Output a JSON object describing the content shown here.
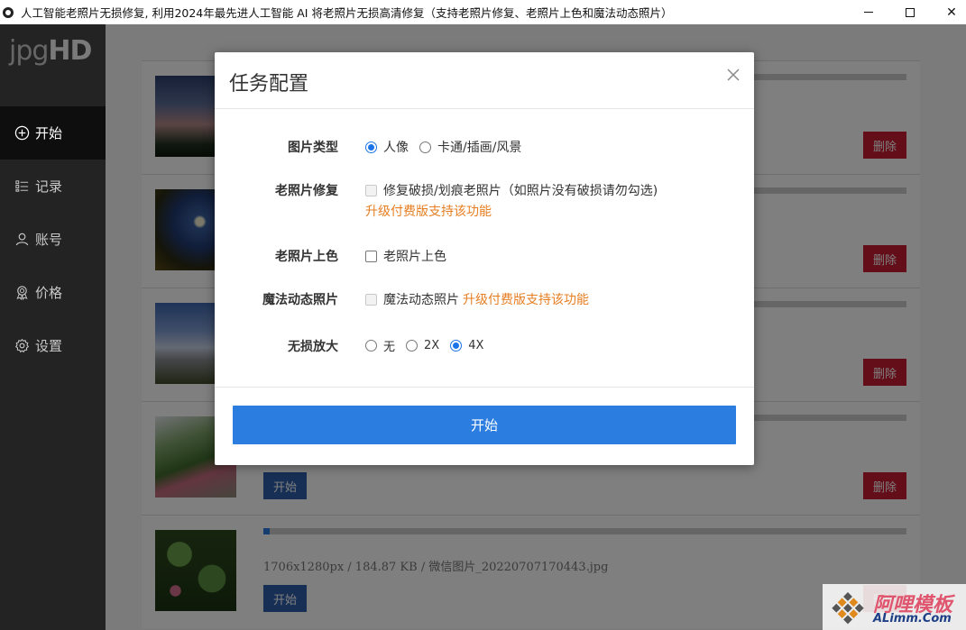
{
  "window": {
    "title": "人工智能老照片无损修复, 利用2024年最先进人工智能 AI 将老照片无损高清修复（支持老照片修复、老照片上色和魔法动态照片）",
    "min_icon": "minimize-icon",
    "max_icon": "maximize-icon",
    "close_glyph": "✕"
  },
  "sidebar": {
    "logo_light": "jpg",
    "logo_bold": "HD",
    "items": [
      {
        "label": "开始",
        "icon": "plus-circle-icon",
        "active": true
      },
      {
        "label": "记录",
        "icon": "list-icon",
        "active": false
      },
      {
        "label": "账号",
        "icon": "user-icon",
        "active": false
      },
      {
        "label": "价格",
        "icon": "award-icon",
        "active": false
      },
      {
        "label": "设置",
        "icon": "gear-icon",
        "active": false
      }
    ]
  },
  "list": {
    "start_label": "开始",
    "delete_label": "删除",
    "items": [
      {
        "meta": "",
        "progress": 0,
        "show_start": false
      },
      {
        "meta": "",
        "progress": 0,
        "show_start": false
      },
      {
        "meta": "",
        "progress": 0,
        "show_start": false
      },
      {
        "meta": "",
        "progress": 0,
        "show_start": true
      },
      {
        "meta": "1706x1280px / 184.87 KB / 微信图片_20220707170443.jpg",
        "progress": 0.01,
        "show_start": true
      }
    ]
  },
  "dialog": {
    "title": "任务配置",
    "close_glyph": "✕",
    "image_type": {
      "label": "图片类型",
      "options": [
        "人像",
        "卡通/插画/风景"
      ],
      "selected": 0
    },
    "restore": {
      "label": "老照片修复",
      "option": "修复破损/划痕老照片（如照片没有破损请勿勾选)",
      "upgrade": "升级付费版支持该功能",
      "checked": false,
      "disabled": true
    },
    "colorize": {
      "label": "老照片上色",
      "option": "老照片上色",
      "checked": false
    },
    "magic": {
      "label": "魔法动态照片",
      "option": "魔法动态照片",
      "upgrade": "升级付费版支持该功能",
      "checked": false,
      "disabled": true
    },
    "upscale": {
      "label": "无损放大",
      "options": [
        "无",
        "2X",
        "4X"
      ],
      "selected": 2
    },
    "start_label": "开始"
  },
  "watermark": {
    "text": "阿哩模板",
    "sub": "ALimm.Com"
  },
  "colors": {
    "accent": "#2b7de0",
    "delete": "#c81d34",
    "upgrade": "#e67e22",
    "sidebar_bg": "#232323"
  }
}
